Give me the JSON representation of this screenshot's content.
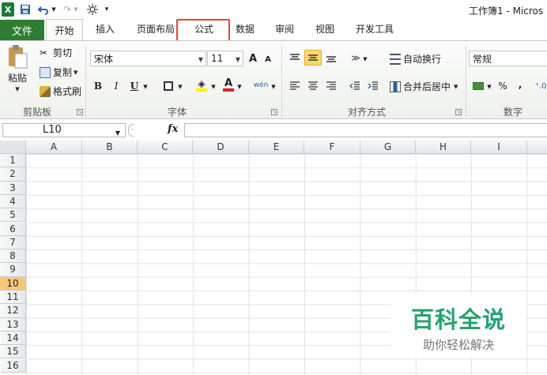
{
  "window": {
    "title": "工作簿1 - Micros"
  },
  "quick_access": {
    "app_icon": "X",
    "save_icon": "save-icon",
    "undo_icon": "undo-icon",
    "redo_icon": "redo-icon",
    "brush_icon": "format-painter-icon",
    "customize_icon": "dropdown-icon"
  },
  "tabs": {
    "file": "文件",
    "home": "开始",
    "insert": "插入",
    "page_layout": "页面布局",
    "formulas": "公式",
    "data": "数据",
    "review": "审阅",
    "view": "视图",
    "developer": "开发工具"
  },
  "ribbon": {
    "clipboard": {
      "paste": "粘贴",
      "cut": "剪切",
      "copy": "复制",
      "format_painter": "格式刷",
      "label": "剪贴板"
    },
    "font": {
      "name": "宋体",
      "size": "11",
      "grow": "A",
      "shrink": "A",
      "bold": "B",
      "italic": "I",
      "underline": "U",
      "font_color_glyph": "A",
      "phonetic": "wén",
      "label": "字体"
    },
    "alignment": {
      "wrap_text": "自动换行",
      "merge_center": "合并后居中",
      "label": "对齐方式"
    },
    "number": {
      "format": "常规",
      "percent": "%",
      "comma": ",",
      "label": "数字"
    }
  },
  "formula_bar": {
    "name_box": "L10",
    "fx": "fx",
    "value": ""
  },
  "sheet": {
    "columns": [
      "A",
      "B",
      "C",
      "D",
      "E",
      "F",
      "G",
      "H",
      "I"
    ],
    "rows": [
      "1",
      "2",
      "3",
      "4",
      "5",
      "6",
      "7",
      "8",
      "9",
      "10",
      "11",
      "12",
      "13",
      "14",
      "15",
      "16"
    ],
    "active_row": "10"
  },
  "watermark": {
    "title": "百科全说",
    "subtitle": "助你轻松解决"
  },
  "colors": {
    "file_tab": "#2e7d32",
    "highlight_border": "#e44444",
    "active_row_header": "#f5c878",
    "watermark_green": "#25a36f"
  }
}
